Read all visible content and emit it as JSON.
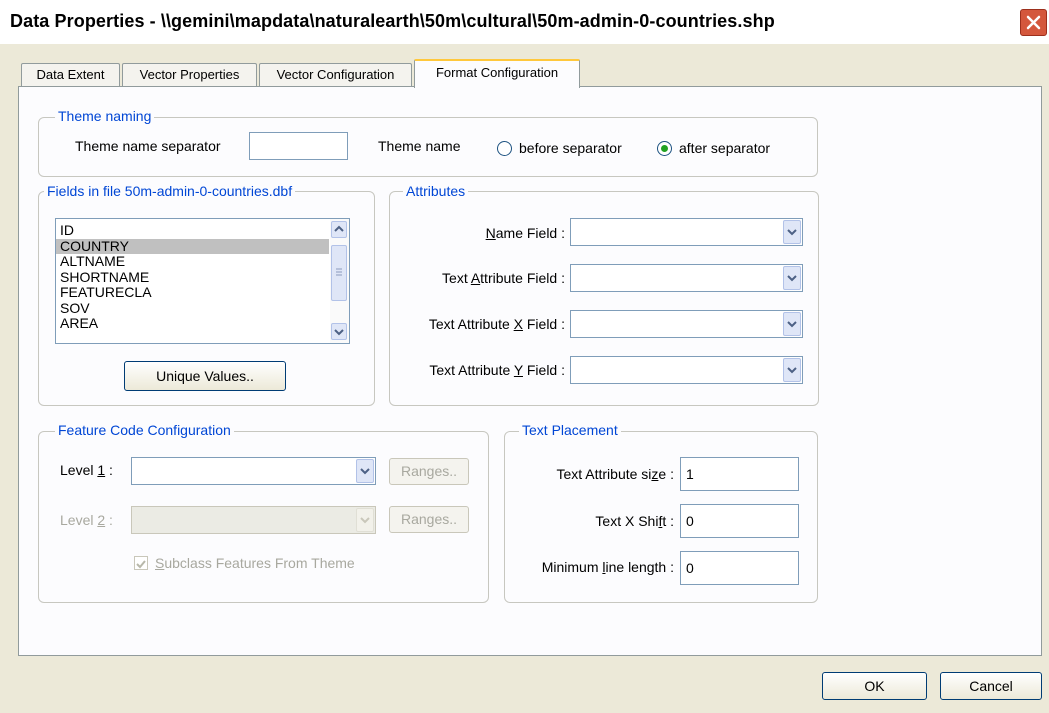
{
  "window": {
    "title": "Data Properties - \\\\gemini\\mapdata\\naturalearth\\50m\\cultural\\50m-admin-0-countries.shp"
  },
  "tabs": [
    {
      "label": "Data Extent",
      "active": false
    },
    {
      "label": "Vector Properties",
      "active": false
    },
    {
      "label": "Vector Configuration",
      "active": false
    },
    {
      "label": "Format Configuration",
      "active": true
    }
  ],
  "theme_naming": {
    "legend": "Theme naming",
    "separator_label": "Theme name separator",
    "separator_value": "",
    "theme_name_label": "Theme name",
    "option_before": "before separator",
    "option_after": "after separator",
    "selected": "after separator"
  },
  "fields": {
    "legend": "Fields in file 50m-admin-0-countries.dbf",
    "items": [
      "ID",
      "COUNTRY",
      "ALTNAME",
      "SHORTNAME",
      "FEATURECLA",
      "SOV",
      "AREA"
    ],
    "selected": "COUNTRY",
    "unique_values_button": "Unique Values.."
  },
  "attributes": {
    "legend": "Attributes",
    "name_field": {
      "pre": "",
      "key": "N",
      "post": "ame Field :",
      "value": ""
    },
    "text_attr_field": {
      "pre": "Text ",
      "key": "A",
      "post": "ttribute Field :",
      "value": ""
    },
    "text_attr_x_field": {
      "pre": "Text Attribute ",
      "key": "X",
      "post": " Field :",
      "value": ""
    },
    "text_attr_y_field": {
      "pre": "Text Attribute ",
      "key": "Y",
      "post": " Field :",
      "value": ""
    }
  },
  "feature_code": {
    "legend": "Feature Code Configuration",
    "level1": {
      "pre": "Level ",
      "key": "1",
      "post": " :",
      "value": "",
      "enabled": true
    },
    "level2": {
      "pre": "Level ",
      "key": "2",
      "post": " :",
      "value": "",
      "enabled": false
    },
    "ranges_label": "Ranges..",
    "subclass": {
      "key": "S",
      "rest": "ubclass Features From Theme",
      "checked": true,
      "enabled": false
    }
  },
  "text_placement": {
    "legend": "Text Placement",
    "size": {
      "pre": "Text Attribute si",
      "key": "z",
      "post": "e :",
      "value": "1"
    },
    "x_shift": {
      "pre": "Text X Shi",
      "key": "f",
      "post": "t :",
      "value": "0"
    },
    "min_line": {
      "pre": "Minimum ",
      "key": "l",
      "post": "ine length :",
      "value": "0"
    }
  },
  "buttons": {
    "ok": "OK",
    "cancel": "Cancel"
  },
  "colors": {
    "legend": "#0046d5",
    "close": "#d4573c",
    "active_tab_highlight": "#ffc83c",
    "radio_dot": "#21a121"
  },
  "icons": [
    "close-icon",
    "chevron-down-icon",
    "scroll-up-icon",
    "scroll-down-icon",
    "check-icon"
  ]
}
